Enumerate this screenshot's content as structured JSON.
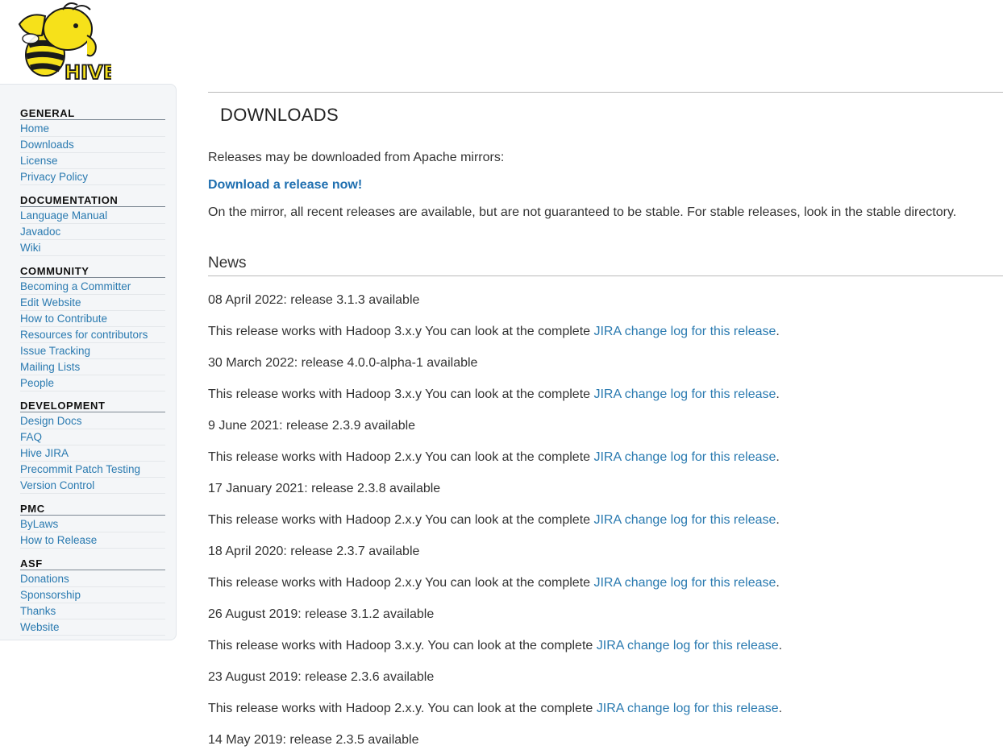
{
  "logo": {
    "text": "HIVE",
    "colors": {
      "yellow": "#f6e11a",
      "black": "#1a1a1a"
    }
  },
  "sidebar": {
    "sections": [
      {
        "heading": "GENERAL",
        "items": [
          "Home",
          "Downloads",
          "License",
          "Privacy Policy"
        ]
      },
      {
        "heading": "DOCUMENTATION",
        "items": [
          "Language Manual",
          "Javadoc",
          "Wiki"
        ]
      },
      {
        "heading": "COMMUNITY",
        "items": [
          "Becoming a Committer",
          "Edit Website",
          "How to Contribute",
          "Resources for contributors",
          "Issue Tracking",
          "Mailing Lists",
          "People"
        ]
      },
      {
        "heading": "DEVELOPMENT",
        "items": [
          "Design Docs",
          "FAQ",
          "Hive JIRA",
          "Precommit Patch Testing",
          "Version Control"
        ]
      },
      {
        "heading": "PMC",
        "items": [
          "ByLaws",
          "How to Release"
        ]
      },
      {
        "heading": "ASF",
        "items": [
          "Donations",
          "Sponsorship",
          "Thanks",
          "Website"
        ]
      }
    ]
  },
  "main": {
    "title": "DOWNLOADS",
    "intro": "Releases may be downloaded from Apache mirrors:",
    "download_link": "Download a release now!",
    "mirror_note": "On the mirror, all recent releases are available, but are not guaranteed to be stable. For stable releases, look in the stable directory.",
    "news_title": "News",
    "news": [
      {
        "headline": "08 April 2022: release 3.1.3 available",
        "text": "This release works with Hadoop 3.x.y You can look at the complete ",
        "link": "JIRA change log for this release",
        "after": "."
      },
      {
        "headline": "30 March 2022: release 4.0.0-alpha-1 available",
        "text": "This release works with Hadoop 3.x.y You can look at the complete ",
        "link": "JIRA change log for this release",
        "after": "."
      },
      {
        "headline": "9 June 2021: release 2.3.9 available",
        "text": "This release works with Hadoop 2.x.y You can look at the complete ",
        "link": "JIRA change log for this release",
        "after": "."
      },
      {
        "headline": "17 January 2021: release 2.3.8 available",
        "text": "This release works with Hadoop 2.x.y You can look at the complete ",
        "link": "JIRA change log for this release",
        "after": "."
      },
      {
        "headline": "18 April 2020: release 2.3.7 available",
        "text": "This release works with Hadoop 2.x.y You can look at the complete ",
        "link": "JIRA change log for this release",
        "after": "."
      },
      {
        "headline": "26 August 2019: release 3.1.2 available",
        "text": "This release works with Hadoop 3.x.y. You can look at the complete ",
        "link": "JIRA change log for this release",
        "after": "."
      },
      {
        "headline": "23 August 2019: release 2.3.6 available",
        "text": "This release works with Hadoop 2.x.y. You can look at the complete ",
        "link": "JIRA change log for this release",
        "after": "."
      },
      {
        "headline": "14 May 2019: release 2.3.5 available"
      }
    ]
  }
}
